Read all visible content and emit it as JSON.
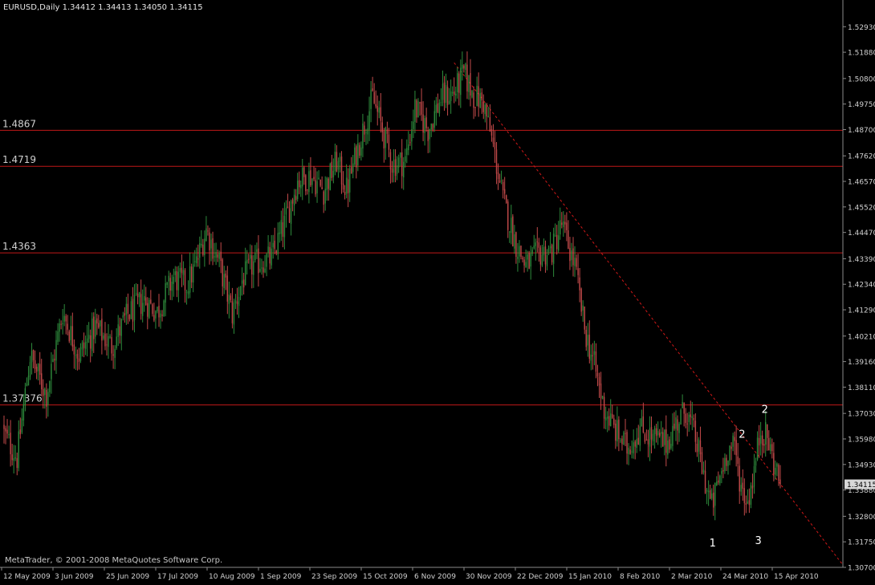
{
  "header": {
    "symbol": "EURUSD,Daily",
    "ohlc": "1.34412 1.34413 1.34050 1.34115"
  },
  "copyright": "MetaTrader, © 2001-2008 MetaQuotes Software Corp.",
  "colors": {
    "background": "#000000",
    "candle_bull": "#2e8b3c",
    "candle_bear": "#c24a4a",
    "level_line": "#c01818",
    "trendline": "#d01818",
    "axis_text": "#d0d0d0",
    "axis_line": "#8a8a8a",
    "current_price_bg": "#d8d8d8"
  },
  "chart_data": {
    "type": "candlestick",
    "symbol": "EURUSD",
    "timeframe": "Daily",
    "ylim": [
      1.307,
      1.535
    ],
    "price_ticks": [
      "1.52930",
      "1.51880",
      "1.50800",
      "1.49750",
      "1.48700",
      "1.47620",
      "1.46570",
      "1.45520",
      "1.44470",
      "1.43390",
      "1.42340",
      "1.41290",
      "1.40210",
      "1.39160",
      "1.38110",
      "1.37030",
      "1.35980",
      "1.34930",
      "1.33880",
      "1.32800",
      "1.31750",
      "1.30700"
    ],
    "date_ticks": [
      "12 May 2009",
      "3 Jun 2009",
      "25 Jun 2009",
      "17 Jul 2009",
      "10 Aug 2009",
      "1 Sep 2009",
      "23 Sep 2009",
      "15 Oct 2009",
      "6 Nov 2009",
      "30 Nov 2009",
      "22 Dec 2009",
      "15 Jan 2010",
      "8 Feb 2010",
      "2 Mar 2010",
      "24 Mar 2010",
      "15 Apr 2010"
    ],
    "current_price": "1.34115",
    "levels": [
      {
        "label": "1.4867",
        "value": 1.4867
      },
      {
        "label": "1.4719",
        "value": 1.4719
      },
      {
        "label": "1.4363",
        "value": 1.4363
      },
      {
        "label": "1.37376",
        "value": 1.37376
      }
    ],
    "trendline": {
      "style": "dashed",
      "from": {
        "date": "25 Nov 2009",
        "price": 1.5145
      },
      "to": {
        "date": "6 May 2010",
        "price": 1.308
      }
    },
    "wave_labels": [
      {
        "text": "1",
        "date": "24 Mar 2010",
        "price": 1.3155
      },
      {
        "text": "2",
        "date": "2 Apr 2010",
        "price": 1.3603
      },
      {
        "text": "3",
        "date": "8 Apr 2010",
        "price": 1.3165
      },
      {
        "text": "2",
        "date": "13 Apr 2010",
        "price": 1.3705
      }
    ],
    "close_path": [
      [
        0,
        1.362
      ],
      [
        8,
        1.352
      ],
      [
        16,
        1.394
      ],
      [
        26,
        1.378
      ],
      [
        36,
        1.412
      ],
      [
        46,
        1.394
      ],
      [
        56,
        1.406
      ],
      [
        66,
        1.398
      ],
      [
        76,
        1.411
      ],
      [
        86,
        1.417
      ],
      [
        94,
        1.412
      ],
      [
        104,
        1.426
      ],
      [
        112,
        1.423
      ],
      [
        118,
        1.432
      ],
      [
        124,
        1.446
      ],
      [
        132,
        1.432
      ],
      [
        140,
        1.411
      ],
      [
        146,
        1.425
      ],
      [
        152,
        1.431
      ],
      [
        158,
        1.433
      ],
      [
        164,
        1.434
      ],
      [
        172,
        1.448
      ],
      [
        180,
        1.466
      ],
      [
        188,
        1.468
      ],
      [
        196,
        1.462
      ],
      [
        204,
        1.474
      ],
      [
        210,
        1.462
      ],
      [
        218,
        1.482
      ],
      [
        226,
        1.5
      ],
      [
        232,
        1.487
      ],
      [
        238,
        1.473
      ],
      [
        246,
        1.474
      ],
      [
        252,
        1.496
      ],
      [
        260,
        1.487
      ],
      [
        268,
        1.5
      ],
      [
        276,
        1.502
      ],
      [
        282,
        1.51
      ],
      [
        288,
        1.501
      ],
      [
        294,
        1.498
      ],
      [
        300,
        1.48
      ],
      [
        306,
        1.458
      ],
      [
        314,
        1.44
      ],
      [
        320,
        1.431
      ],
      [
        328,
        1.436
      ],
      [
        336,
        1.437
      ],
      [
        342,
        1.448
      ],
      [
        350,
        1.431
      ],
      [
        356,
        1.405
      ],
      [
        362,
        1.39
      ],
      [
        368,
        1.372
      ],
      [
        374,
        1.364
      ],
      [
        382,
        1.356
      ],
      [
        390,
        1.364
      ],
      [
        398,
        1.36
      ],
      [
        406,
        1.358
      ],
      [
        412,
        1.366
      ],
      [
        418,
        1.372
      ],
      [
        424,
        1.36
      ],
      [
        430,
        1.342
      ],
      [
        434,
        1.332
      ],
      [
        438,
        1.342
      ],
      [
        444,
        1.356
      ],
      [
        448,
        1.356
      ],
      [
        452,
        1.34
      ],
      [
        456,
        1.334
      ],
      [
        460,
        1.347
      ],
      [
        464,
        1.364
      ],
      [
        468,
        1.36
      ],
      [
        472,
        1.35
      ],
      [
        476,
        1.3411
      ]
    ]
  }
}
